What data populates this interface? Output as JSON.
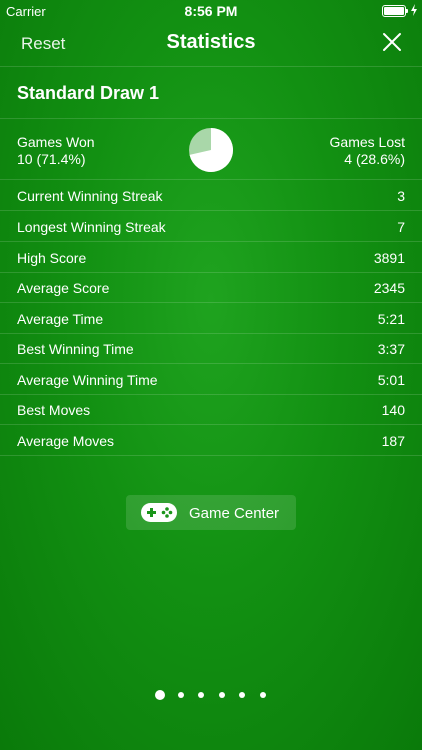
{
  "status_bar": {
    "carrier": "Carrier",
    "time": "8:56 PM",
    "battery_level": 1.0
  },
  "nav": {
    "reset_label": "Reset",
    "title": "Statistics",
    "close_icon": "close-icon"
  },
  "section": {
    "title": "Standard Draw 1"
  },
  "summary": {
    "won_label": "Games Won",
    "won_value": "10 (71.4%)",
    "lost_label": "Games Lost",
    "lost_value": "4 (28.6%)",
    "won_fraction": 0.714,
    "lost_fraction": 0.286
  },
  "stats": [
    {
      "label": "Current Winning Streak",
      "value": "3"
    },
    {
      "label": "Longest Winning Streak",
      "value": "7"
    },
    {
      "label": "High Score",
      "value": "3891"
    },
    {
      "label": "Average Score",
      "value": "2345"
    },
    {
      "label": "Average Time",
      "value": "5:21"
    },
    {
      "label": "Best Winning Time",
      "value": "3:37"
    },
    {
      "label": "Average Winning Time",
      "value": "5:01"
    },
    {
      "label": "Best Moves",
      "value": "140"
    },
    {
      "label": "Average Moves",
      "value": "187"
    }
  ],
  "game_center": {
    "label": "Game Center",
    "icon": "gamepad-icon"
  },
  "pager": {
    "count": 6,
    "active_index": 0
  },
  "colors": {
    "background": "#129012",
    "pie_won": "#ffffff",
    "pie_lost": "#a9d7a9"
  }
}
